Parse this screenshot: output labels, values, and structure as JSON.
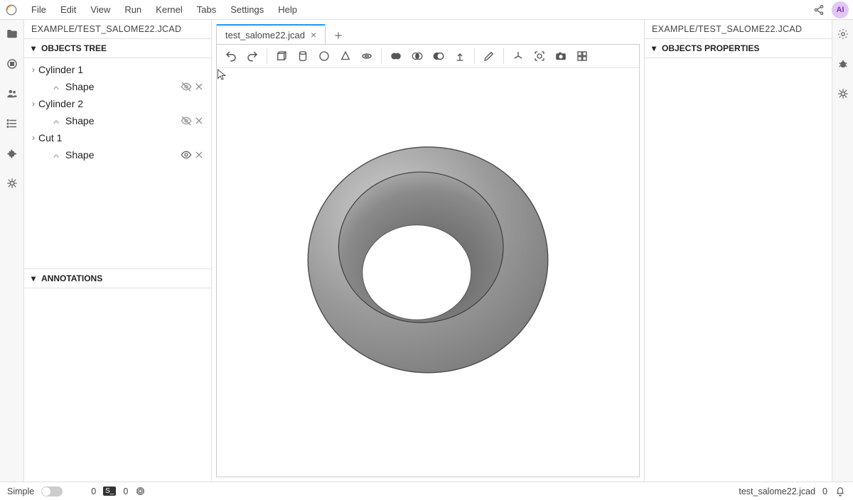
{
  "menu": {
    "items": [
      "File",
      "Edit",
      "View",
      "Run",
      "Kernel",
      "Tabs",
      "Settings",
      "Help"
    ],
    "avatar_initials": "AI"
  },
  "left": {
    "title": "EXAMPLE/TEST_SALOME22.JCAD",
    "objects_header": "OBJECTS TREE",
    "annotations_header": "ANNOTATIONS",
    "tree": [
      {
        "name": "Cylinder 1",
        "expandable": true,
        "shape": {
          "label": "Shape",
          "visible": false
        }
      },
      {
        "name": "Cylinder 2",
        "expandable": true,
        "shape": {
          "label": "Shape",
          "visible": false
        }
      },
      {
        "name": "Cut 1",
        "expandable": true,
        "shape": {
          "label": "Shape",
          "visible": true
        }
      }
    ]
  },
  "center": {
    "tab_label": "test_salome22.jcad",
    "toolbar_icons": [
      "undo",
      "redo",
      "box",
      "cylinder",
      "circle",
      "cone",
      "torus",
      "union",
      "intersection",
      "difference",
      "extrude",
      "edit",
      "axes",
      "focus",
      "camera",
      "grid"
    ]
  },
  "right": {
    "title": "EXAMPLE/TEST_SALOME22.JCAD",
    "props_header": "OBJECTS PROPERTIES"
  },
  "status": {
    "mode": "Simple",
    "kernel_count": "0",
    "term_label": "S_",
    "term_count": "0",
    "filename": "test_salome22.jcad",
    "right_count": "0"
  },
  "colors": {
    "accent": "#2196f3"
  }
}
